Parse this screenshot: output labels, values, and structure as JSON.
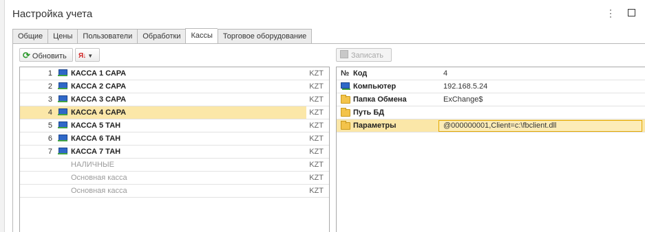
{
  "window": {
    "title": "Настройка учета",
    "menu_icon": "more-vert-icon",
    "maximize_icon": "maximize-icon"
  },
  "tabs": [
    {
      "label": "Общие",
      "active": false
    },
    {
      "label": "Цены",
      "active": false
    },
    {
      "label": "Пользователи",
      "active": false
    },
    {
      "label": "Обработки",
      "active": false
    },
    {
      "label": "Кассы",
      "active": true
    },
    {
      "label": "Торговое оборудование",
      "active": false
    }
  ],
  "toolbar": {
    "refresh_label": "Обновить",
    "refresh_icon": "refresh-icon",
    "sort_icon": "sort-az-icon",
    "write_label": "Записать",
    "write_icon": "save-icon",
    "write_enabled": false
  },
  "registers": [
    {
      "num": "1",
      "name": "КАССА 1 САРА",
      "currency": "KZT",
      "active": true,
      "selected": false
    },
    {
      "num": "2",
      "name": "КАССА 2 САРА",
      "currency": "KZT",
      "active": true,
      "selected": false
    },
    {
      "num": "3",
      "name": "КАССА 3 САРА",
      "currency": "KZT",
      "active": true,
      "selected": false
    },
    {
      "num": "4",
      "name": "КАССА 4 САРА",
      "currency": "KZT",
      "active": true,
      "selected": true
    },
    {
      "num": "5",
      "name": "КАССА 5 ТАН",
      "currency": "KZT",
      "active": true,
      "selected": false
    },
    {
      "num": "6",
      "name": "КАССА 6 ТАН",
      "currency": "KZT",
      "active": true,
      "selected": false
    },
    {
      "num": "7",
      "name": "КАССА 7 ТАН",
      "currency": "KZT",
      "active": true,
      "selected": false
    },
    {
      "num": "",
      "name": "НАЛИЧНЫЕ",
      "currency": "KZT",
      "active": false,
      "selected": false
    },
    {
      "num": "",
      "name": "Основная касса",
      "currency": "KZT",
      "active": false,
      "selected": false
    },
    {
      "num": "",
      "name": "Основная касса",
      "currency": "KZT",
      "active": false,
      "selected": false
    }
  ],
  "properties": [
    {
      "icon": "number-sign-icon",
      "label": "Код",
      "value": "4",
      "selected": false
    },
    {
      "icon": "computer-icon",
      "label": "Компьютер",
      "value": "192.168.5.24",
      "selected": false
    },
    {
      "icon": "folder-icon",
      "label": "Папка Обмена",
      "value": "ExChange$",
      "selected": false
    },
    {
      "icon": "folder-icon",
      "label": "Путь БД",
      "value": "",
      "selected": false
    },
    {
      "icon": "folder-icon",
      "label": "Параметры",
      "value": "@000000001,Client=c:\\fbclient.dll",
      "selected": true
    }
  ]
}
